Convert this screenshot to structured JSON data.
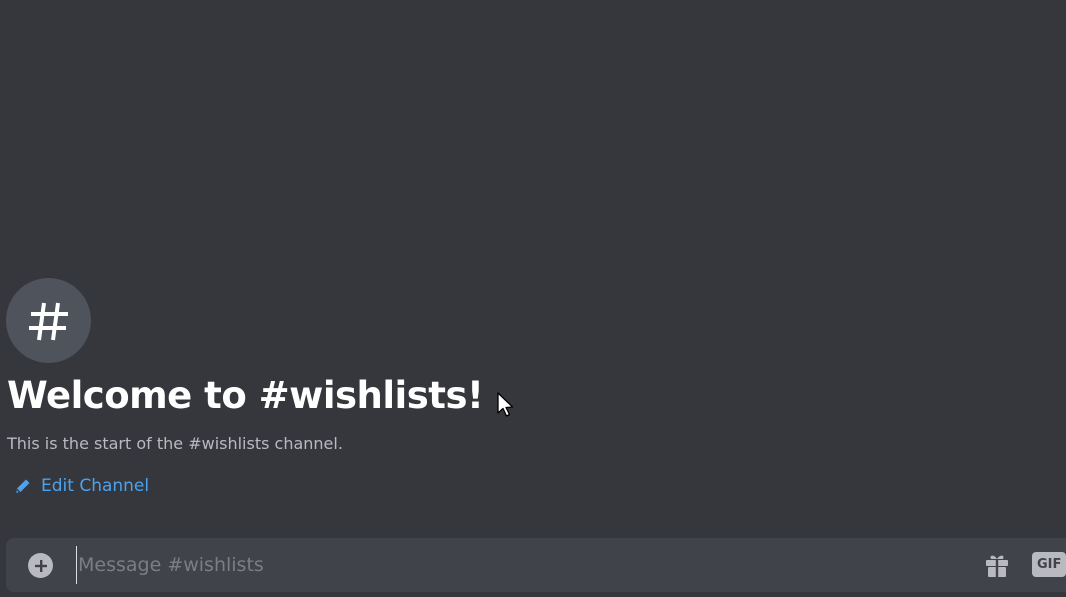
{
  "channel": {
    "icon": "hash-icon",
    "welcome_title": "Welcome to #wishlists!",
    "welcome_subtitle": "This is the start of the #wishlists channel."
  },
  "actions": {
    "edit_channel_label": "Edit Channel",
    "edit_icon": "pencil-icon"
  },
  "composer": {
    "placeholder": "Message #wishlists",
    "value": "",
    "add_icon": "plus-circle-icon",
    "gift_icon": "gift-icon",
    "gif_label": "GIF"
  },
  "colors": {
    "background": "#36373d",
    "link": "#4aa3f0",
    "composer_bg": "#40434a"
  }
}
